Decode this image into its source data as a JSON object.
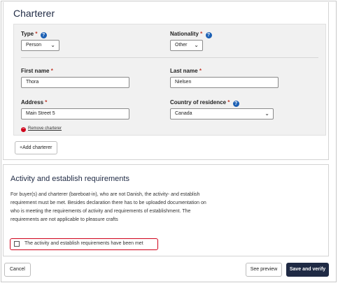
{
  "charterer": {
    "title": "Charterer",
    "type": {
      "label": "Type",
      "required": "*",
      "value": "Person"
    },
    "nationality": {
      "label": "Nationality",
      "required": "*",
      "value": "Other"
    },
    "first_name": {
      "label": "First name",
      "required": "*",
      "value": "Thora"
    },
    "last_name": {
      "label": "Last name",
      "required": "*",
      "value": "Nielsen"
    },
    "address": {
      "label": "Address",
      "required": "*",
      "value": "Main Street 5"
    },
    "country": {
      "label": "Country of residence",
      "required": "*",
      "value": "Canada"
    },
    "remove_label": "Remove charterer",
    "add_label": "+Add charterer",
    "help_glyph": "?"
  },
  "requirements": {
    "title": "Activity and establish requirements",
    "text": "For buyer(s) and charterer (bareboat-in), who are not Danish, the activity- and establish requirement must be met. Besides declaration there has to be uploaded documentation on who is meeting the requirements of activity and requirements of establishment. The requirements are not applicable to pleasure crafts",
    "checkbox_label": "The activity and establish requirements have been met",
    "checked": false
  },
  "footer": {
    "cancel_label": "Cancel",
    "preview_label": "See preview",
    "save_label": "Save and verify"
  },
  "colors": {
    "primary": "#1f2a44",
    "help_icon": "#1a5fb4",
    "required": "#c0392b",
    "highlight": "#d0021b"
  }
}
